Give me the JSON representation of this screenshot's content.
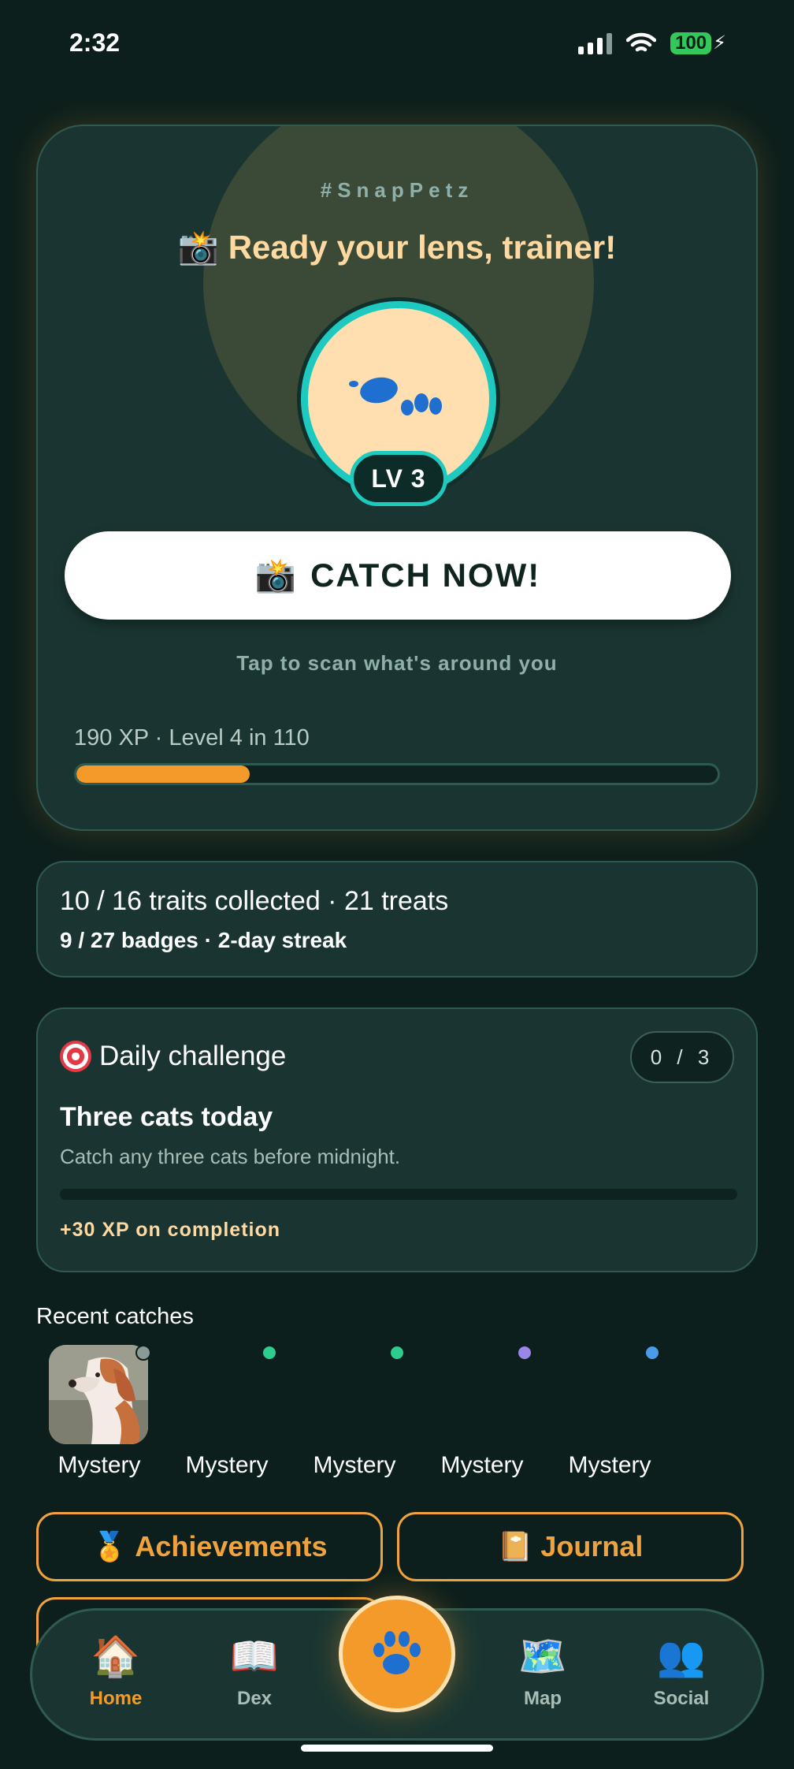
{
  "status": {
    "time": "2:32",
    "battery": "100"
  },
  "hero": {
    "tag": "#SnapPetz",
    "title": "📸 Ready your lens, trainer!",
    "level": "LV 3",
    "catch_icon": "📸",
    "catch_label": "CATCH NOW!",
    "catch_sub": "Tap to scan what's around you",
    "xp_text": "190 XP · Level 4 in 110",
    "xp_progress": 0.27
  },
  "stats": {
    "line1": "10 / 16 traits collected · 21 treats",
    "line2": "9 / 27 badges · 2-day streak"
  },
  "challenge": {
    "heading": "Daily challenge",
    "count": "0 / 3",
    "title": "Three cats today",
    "description": "Catch any three cats before midnight.",
    "progress": 0,
    "reward": "+30 XP on completion"
  },
  "recent": {
    "heading": "Recent catches",
    "items": [
      {
        "label": "Mystery",
        "dot_color": "#8a9a96",
        "has_photo": true
      },
      {
        "label": "Mystery",
        "dot_color": "#2ecc8f",
        "has_photo": false
      },
      {
        "label": "Mystery",
        "dot_color": "#2ecc8f",
        "has_photo": false
      },
      {
        "label": "Mystery",
        "dot_color": "#9b87e8",
        "has_photo": false
      },
      {
        "label": "Mystery",
        "dot_color": "#4a9be8",
        "has_photo": false
      }
    ]
  },
  "actions": {
    "achievements_icon": "🏅",
    "achievements_label": "Achievements",
    "journal_icon": "📔",
    "journal_label": "Journal"
  },
  "tabs": [
    {
      "icon": "🏠",
      "label": "Home",
      "active": true,
      "icon_name": "home-icon"
    },
    {
      "icon": "📖",
      "label": "Dex",
      "active": false,
      "icon_name": "book-icon"
    },
    {
      "icon": "🗺️",
      "label": "Map",
      "active": false,
      "icon_name": "map-icon"
    },
    {
      "icon": "👥",
      "label": "Social",
      "active": false,
      "icon_name": "people-icon"
    }
  ],
  "colors": {
    "accent": "#f39a2b",
    "teal": "#1ec9c0",
    "card": "#1a3531",
    "background": "#0d1f1c"
  }
}
